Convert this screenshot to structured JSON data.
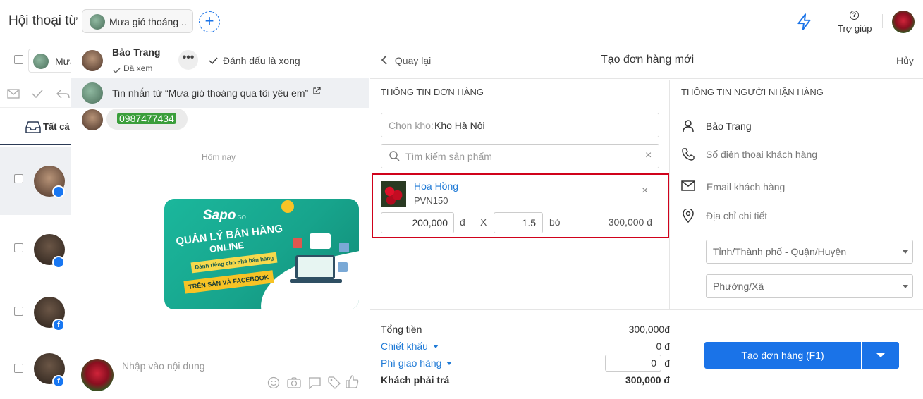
{
  "header": {
    "title": "Hội thoại từ",
    "page_chip": "Mưa gió thoáng ..",
    "help_label": "Trợ giúp"
  },
  "left": {
    "page_tab": "Mưa",
    "inbox_tab": "Tất cả"
  },
  "chat": {
    "contact_name": "Bảo Trang",
    "seen_status": "Đã xem",
    "mark_done": "Đánh dấu là xong",
    "source_message": "Tin nhắn từ  “Mưa gió thoáng qua tôi yêu em”",
    "phone_bubble": "0987477434",
    "date_divider": "Hôm nay",
    "banner": {
      "brand": "Sapo",
      "brand_suffix": "GO",
      "headline_1": "QUẢN LÝ BÁN HÀNG",
      "headline_2": "ONLINE",
      "tagline": "Dành riêng cho nhà bán hàng",
      "cta": "TRÊN SÀN VÀ FACEBOOK"
    },
    "composer_placeholder": "Nhập vào nội dung"
  },
  "order": {
    "back_label": "Quay lại",
    "title": "Tạo đơn hàng mới",
    "cancel_label": "Hủy",
    "order_section": "THÔNG TIN ĐƠN HÀNG",
    "warehouse_label": "Chọn kho:",
    "warehouse_value": "Kho Hà Nội",
    "product_search_placeholder": "Tìm kiếm sản phẩm",
    "line_item": {
      "name": "Hoa Hồng",
      "sku": "PVN150",
      "price": "200,000",
      "currency": "đ",
      "times": "X",
      "quantity": "1.5",
      "unit": "bó",
      "line_total": "300,000 đ"
    },
    "recipient_section": "THÔNG TIN NGƯỜI NHẬN HÀNG",
    "recipient": {
      "name": "Bảo Trang",
      "phone_placeholder": "Số điện thoại khách hàng",
      "email_placeholder": "Email khách hàng",
      "address_placeholder": "Địa chỉ chi tiết",
      "province_select": "Tỉnh/Thành phố - Quận/Huyện",
      "ward_select": "Phường/Xã"
    },
    "summary": {
      "total_label": "Tổng tiền",
      "total_value": "300,000đ",
      "discount_label": "Chiết khấu",
      "discount_value": "0 đ",
      "shipping_label": "Phí giao hàng",
      "shipping_value": "0",
      "shipping_currency": "đ",
      "payable_label": "Khách phải trả",
      "payable_value": "300,000 đ"
    },
    "submit_label": "Tạo đơn hàng (F1)"
  },
  "colors": {
    "primary_blue": "#1a73e8",
    "link_blue": "#1f7ad6",
    "highlight_red": "#d0021b",
    "phone_green": "#3b9e3b"
  }
}
